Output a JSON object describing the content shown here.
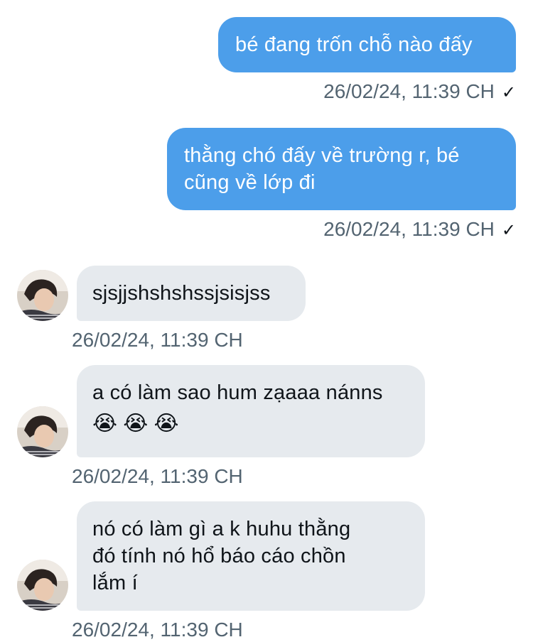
{
  "messages": [
    {
      "direction": "sent",
      "lines": [
        "bé đang trốn chỗ nào đấy"
      ],
      "timestamp": "26/02/24, 11:39 CH",
      "check": "✓"
    },
    {
      "direction": "sent",
      "lines": [
        "thằng chó đấy về trường r, bé",
        "cũng về lớp đi"
      ],
      "timestamp": "26/02/24, 11:39 CH",
      "check": "✓"
    },
    {
      "direction": "received",
      "lines": [
        "sjsjjshshshssjsisjss"
      ],
      "timestamp": "26/02/24, 11:39 CH"
    },
    {
      "direction": "received",
      "lines": [
        "a có làm sao hum zạaaa nánns"
      ],
      "emojis": [
        "😭",
        "😭",
        "😭"
      ],
      "timestamp": "26/02/24, 11:39 CH"
    },
    {
      "direction": "received",
      "lines": [
        "nó có làm gì a k huhu thằng",
        "đó tính nó hổ báo cáo chồn",
        "lắm í"
      ],
      "timestamp": "26/02/24, 11:39 CH"
    }
  ],
  "colors": {
    "sent_bubble": "#4c9eea",
    "received_bubble": "#e6eaee",
    "timestamp_text": "#536471"
  },
  "icons": {
    "avatar": "contact-avatar-photo",
    "read_receipt": "check-icon",
    "emoji": "loudly-crying-face-emoji"
  }
}
